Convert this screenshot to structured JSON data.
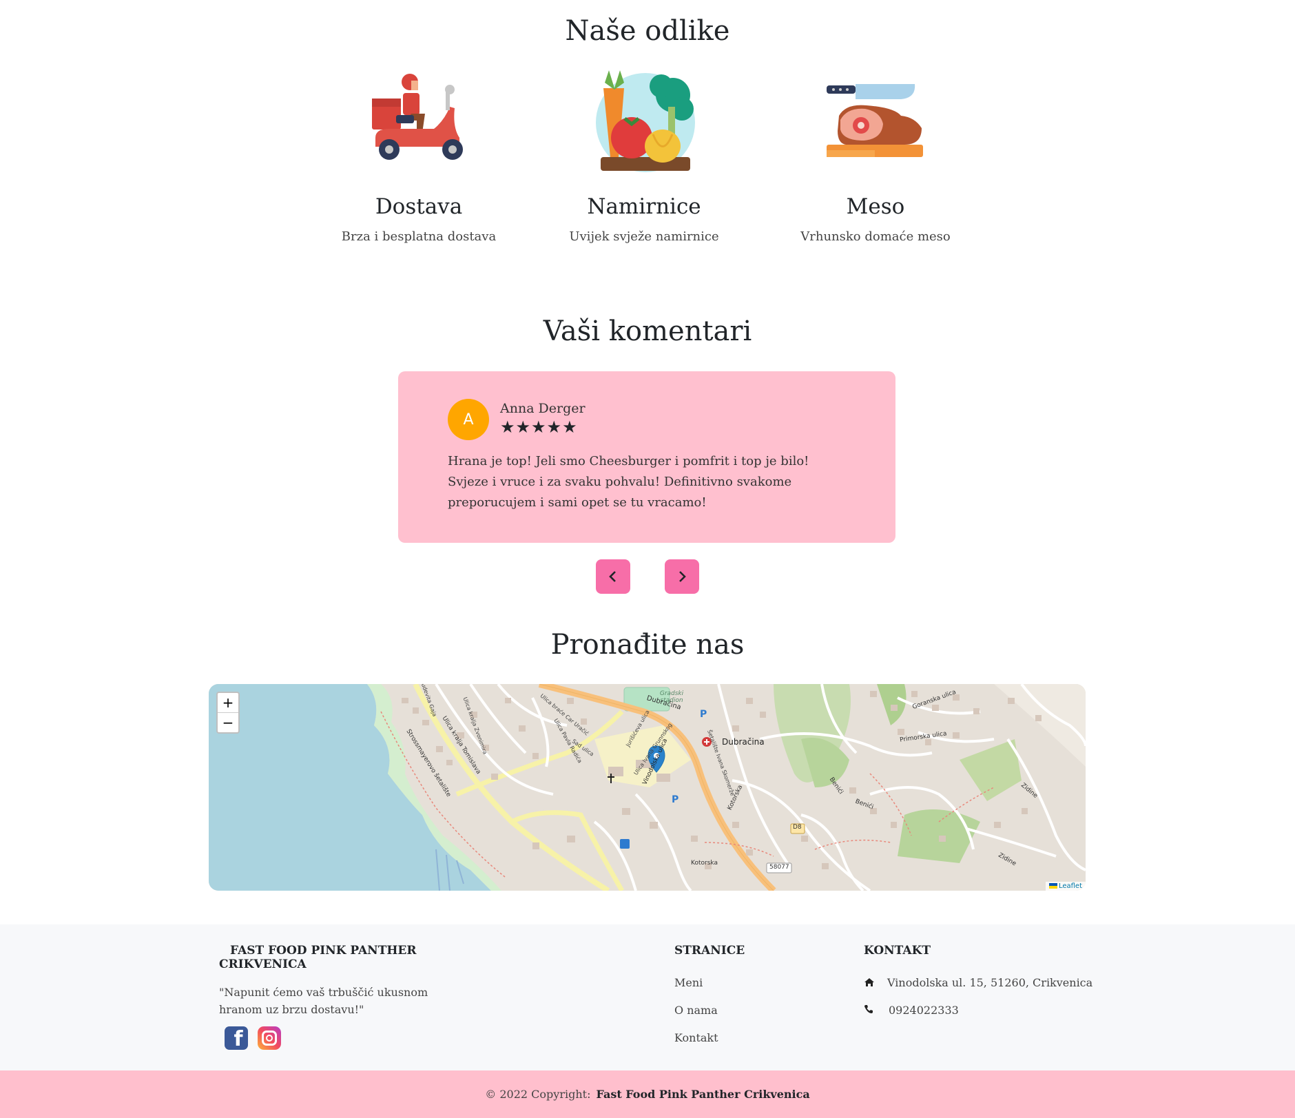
{
  "features": {
    "heading": "Naše odlike",
    "items": [
      {
        "title": "Dostava",
        "subtitle": "Brza i besplatna dostava",
        "icon": "delivery-scooter-icon"
      },
      {
        "title": "Namirnice",
        "subtitle": "Uvijek svježe namirnice",
        "icon": "vegetables-icon"
      },
      {
        "title": "Meso",
        "subtitle": "Vrhunsko domaće meso",
        "icon": "meat-icon"
      }
    ]
  },
  "comments": {
    "heading": "Vaši komentari",
    "review": {
      "avatar_letter": "A",
      "author": "Anna Derger",
      "rating": 5,
      "stars": "★★★★★",
      "text": "Hrana je top! Jeli smo Cheesburger i pomfrit i top je bilo! Svjeze i vruce i za svaku pohvalu! Definitivno svakome preporucujem i sami opet se tu vracamo!"
    },
    "prev_icon": "chevron-left-icon",
    "next_icon": "chevron-right-icon"
  },
  "location": {
    "heading": "Pronađite nas",
    "map": {
      "zoom_in": "+",
      "zoom_out": "−",
      "attribution": "Leaflet",
      "labels": {
        "stadium": "Gradski stadion",
        "dubracina_street": "Dubračina",
        "dubracina_place": "Dubračina",
        "primorska": "Primorska ulica",
        "goranska": "Goranska ulica",
        "tomislava": "Ulica kralja Tomislava",
        "strossmayer": "Strossmayerovo šetalište",
        "vinodolska": "Vinodolska ulica",
        "kotorska": "Kotorska",
        "kotorska2": "Kotorska",
        "benici": "Benići",
        "benici2": "Benići",
        "zidine": "Zidine",
        "zidine2": "Zidine",
        "road_d8": "D8",
        "road_58077": "58077",
        "parking": "P",
        "parking2": "P",
        "gajeva": "Ulica Ljudevita Gaja",
        "zvonimira": "Ulica kralja Zvonimira",
        "braca": "Ulica braće Car Uračić",
        "sad": "Sad ulica",
        "radica": "Ulica Pavla Radića",
        "juriseva": "Jurišićeva ulica",
        "grunskiulica": "Ulica Ivana Grunnskog",
        "setaliste": "Šetalište Ivana Skomerže"
      }
    }
  },
  "footer": {
    "brand_line1": "FAST FOOD PINK PANTHER",
    "brand_line2": "CRIKVENICA",
    "tagline": "\"Napunit ćemo vaš trbuščić ukusnom hranom uz brzu dostavu!\"",
    "pages_heading": "STRANICE",
    "pages": [
      "Meni",
      "O nama",
      "Kontakt"
    ],
    "contact_heading": "KONTAKT",
    "address": "Vinodolska ul. 15, 51260, Crikvenica",
    "phone": "0924022333",
    "copyright_prefix": "© 2022 Copyright:",
    "copyright_name": "Fast Food Pink Panther Crikvenica",
    "colors": {
      "pink": "#ffbfcd",
      "button_pink": "#f76ea8",
      "avatar": "#ffa600"
    }
  }
}
